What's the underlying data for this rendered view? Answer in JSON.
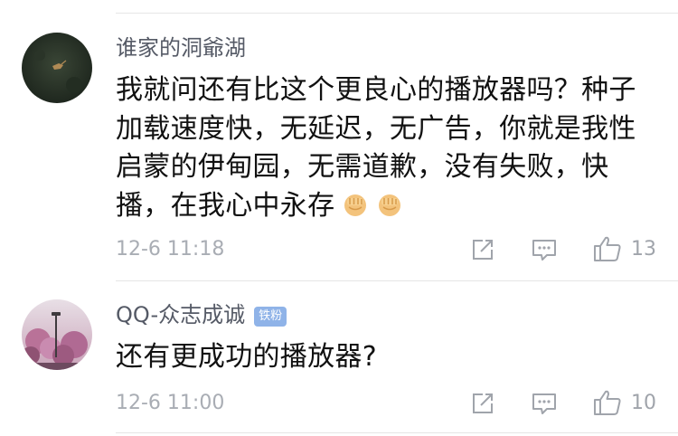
{
  "comments": [
    {
      "username": "谁家的洞爺湖",
      "text": "我就问还有比这个更良心的播放器吗？种子加载速度快，无延迟，无广告，你就是我性启蒙的伊甸园，无需道歉，没有失败，快播，在我心中永存",
      "emoji": [
        "fist-emoji",
        "fist-emoji"
      ],
      "time": "12-6 11:18",
      "likes": "13",
      "badge": null
    },
    {
      "username": "QQ-众志成诚",
      "badge": "铁粉",
      "text": "还有更成功的播放器?",
      "time": "12-6 11:00",
      "likes": "10"
    }
  ],
  "icons": {
    "share": "share-icon",
    "comment": "comment-icon",
    "like": "thumbs-up-icon"
  },
  "colors": {
    "username": "#555a66",
    "meta": "#a9adb4",
    "badge": "#8fb3e8",
    "text": "#111111"
  }
}
